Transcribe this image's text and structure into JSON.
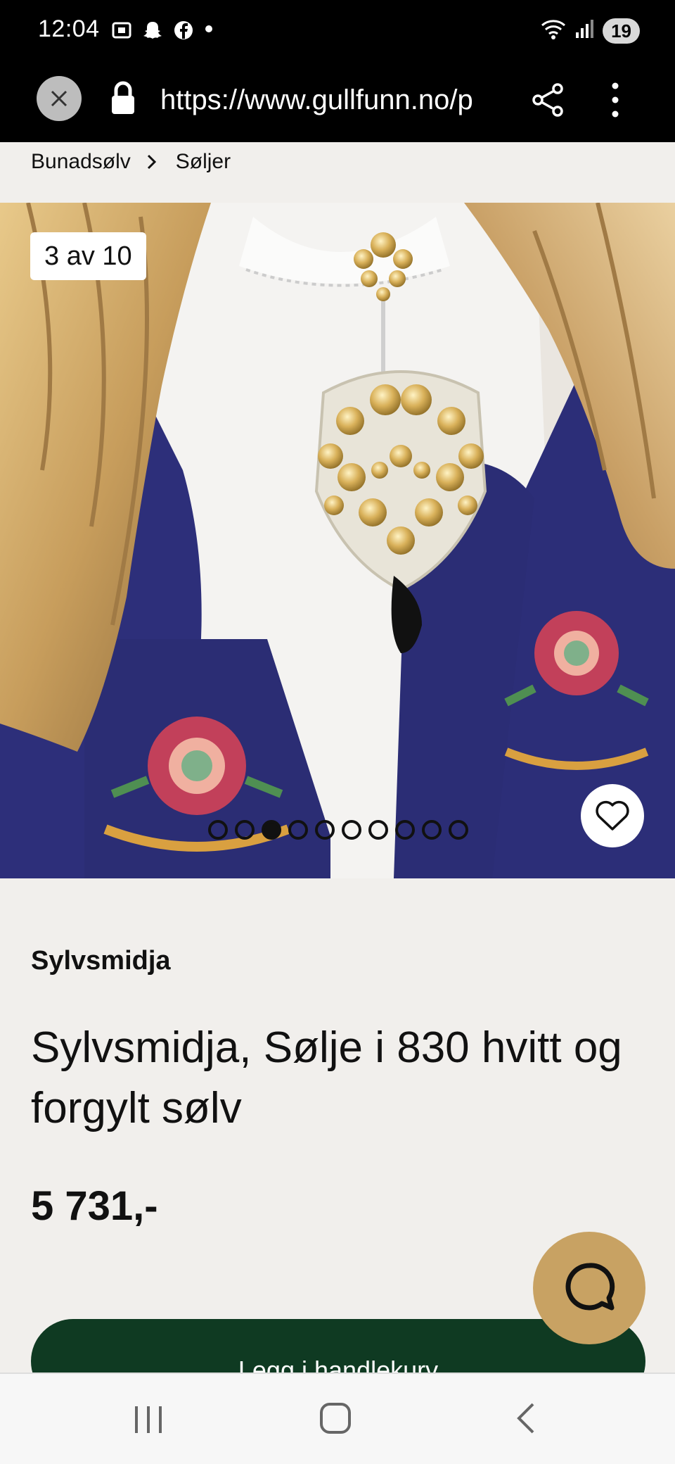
{
  "status_bar": {
    "time": "12:04",
    "battery": "19"
  },
  "browser": {
    "url": "https://www.gullfunn.no/p",
    "icons": [
      "close-icon",
      "lock-icon",
      "share-icon",
      "more-vert-icon"
    ]
  },
  "breadcrumb": {
    "items": [
      "Bunadsølv",
      "Søljer"
    ]
  },
  "gallery": {
    "counter": "3 av 10",
    "total_images": 10,
    "active_index": 3
  },
  "product": {
    "brand": "Sylvsmidja",
    "title": "Sylvsmidja, Sølje i 830 hvitt og forgylt sølv",
    "price": "5 731,-",
    "add_to_cart": "Legg i handlekurv"
  },
  "colors": {
    "cart_button": "#0f3a22",
    "chat_button": "#c8a263",
    "page_background": "#f1efec"
  }
}
